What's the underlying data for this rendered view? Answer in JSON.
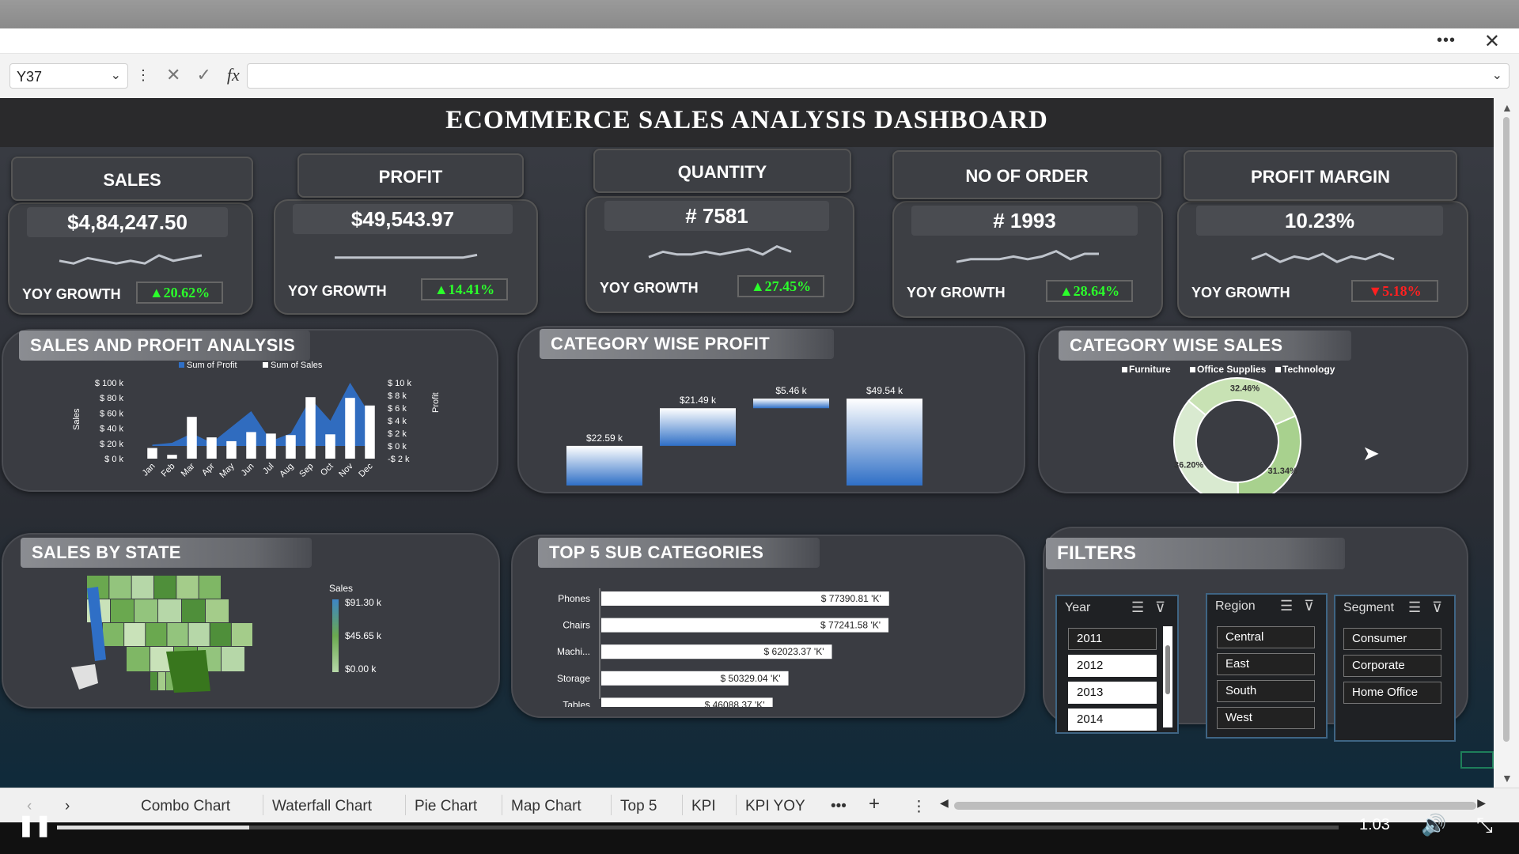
{
  "window": {
    "more_icon": "ellipsis-icon",
    "close_icon": "close-icon"
  },
  "formula_bar": {
    "name_box": "Y37",
    "formula": ""
  },
  "dashboard": {
    "title": "ECOMMERCE SALES ANALYSIS DASHBOARD",
    "kpis": [
      {
        "label": "SALES",
        "value": "$4,84,247.50",
        "yoy_label": "YOY GROWTH",
        "yoy": "20.62%",
        "direction": "up",
        "spark": [
          3,
          2,
          4,
          3,
          2,
          3,
          2,
          5,
          3,
          4,
          5
        ]
      },
      {
        "label": "PROFIT",
        "value": "$49,543.97",
        "yoy_label": "YOY GROWTH",
        "yoy": "14.41%",
        "direction": "up",
        "spark": [
          3,
          3,
          3,
          3,
          3,
          3,
          3,
          3,
          3,
          3,
          4
        ]
      },
      {
        "label": "QUANTITY",
        "value": "# 7581",
        "yoy_label": "YOY GROWTH",
        "yoy": "27.45%",
        "direction": "up",
        "spark": [
          2,
          4,
          3,
          3,
          4,
          3,
          4,
          5,
          3,
          6,
          4
        ]
      },
      {
        "label": "NO OF  ORDER",
        "value": "# 1993",
        "yoy_label": "YOY GROWTH",
        "yoy": "28.64%",
        "direction": "up",
        "spark": [
          2,
          3,
          3,
          3,
          4,
          3,
          4,
          6,
          3,
          5,
          5
        ]
      },
      {
        "label": "PROFIT MARGIN",
        "value": "10.23%",
        "yoy_label": "YOY GROWTH",
        "yoy": "5.18%",
        "direction": "down",
        "spark": [
          3,
          5,
          2,
          4,
          3,
          5,
          2,
          4,
          3,
          5,
          3
        ]
      }
    ],
    "colors": {
      "up": "#2bff2b",
      "down": "#ff2020",
      "profit": "#2f6fc6",
      "sales": "#ffffff",
      "furniture": "#d9ead0",
      "office": "#a8d18e",
      "technology": "#c8e2b4"
    }
  },
  "combo": {
    "title": "SALES AND PROFIT ANALYSIS",
    "legend": [
      "Sum of Profit",
      "Sum of Sales"
    ],
    "left_axis_title": "Sales",
    "right_axis_title": "Profit",
    "left_ticks": [
      "$ 100 k",
      "$ 80 k",
      "$ 60 k",
      "$ 40 k",
      "$ 20 k",
      "$ 0 k"
    ],
    "right_ticks": [
      "$ 10 k",
      "$ 8 k",
      "$ 6 k",
      "$ 4 k",
      "$ 2 k",
      "$ 0 k",
      "-$ 2 k"
    ]
  },
  "waterfall": {
    "title": "CATEGORY WISE PROFIT"
  },
  "donut": {
    "title": "CATEGORY WISE SALES"
  },
  "map": {
    "title": "SALES BY STATE",
    "legend_title": "Sales",
    "legend_ticks": [
      "$91.30 k",
      "$45.65 k",
      "$0.00 k"
    ]
  },
  "top5": {
    "title": "TOP  5 SUB CATEGORIES"
  },
  "chart_data": [
    {
      "type": "bar",
      "title": "SALES AND PROFIT ANALYSIS",
      "categories": [
        "Jan",
        "Feb",
        "Mar",
        "Apr",
        "May",
        "Jun",
        "Jul",
        "Aug",
        "Sep",
        "Oct",
        "Nov",
        "Dec"
      ],
      "series": [
        {
          "name": "Sum of Sales",
          "type": "bar",
          "axis": "left",
          "values": [
            14000,
            5000,
            55000,
            28000,
            23000,
            35000,
            33000,
            31000,
            81000,
            32000,
            80000,
            70000
          ]
        },
        {
          "name": "Sum of Profit",
          "type": "area",
          "axis": "right",
          "values": [
            0.2,
            0.5,
            2.0,
            0.5,
            3.0,
            5.5,
            0.8,
            2.0,
            7.5,
            4.0,
            10.0,
            5.0
          ]
        }
      ],
      "xlabel": "",
      "ylabel": "Sales",
      "y2label": "Profit",
      "ylim": [
        0,
        100000
      ],
      "y2lim": [
        -2,
        10
      ],
      "legend": "top"
    },
    {
      "type": "bar",
      "subtype": "waterfall",
      "title": "CATEGORY WISE PROFIT",
      "categories": [
        "Furniture",
        "Office Supplies",
        "Technology",
        "Total"
      ],
      "values": [
        22.59,
        21.49,
        5.46,
        49.54
      ],
      "labels": [
        "$22.59 k",
        "$21.49 k",
        "$5.46 k",
        "$49.54 k"
      ],
      "ylim": [
        0,
        55
      ]
    },
    {
      "type": "pie",
      "subtype": "donut",
      "title": "CATEGORY WISE SALES",
      "categories": [
        "Furniture",
        "Office Supplies",
        "Technology"
      ],
      "values": [
        36.2,
        31.34,
        32.46
      ],
      "labels": [
        "36.20%",
        "31.34%",
        "32.46%"
      ],
      "legend": "top"
    },
    {
      "type": "bar",
      "orientation": "horizontal",
      "title": "TOP  5 SUB CATEGORIES",
      "categories": [
        "Phones",
        "Chairs",
        "Machi...",
        "Storage",
        "Tables"
      ],
      "values": [
        77390.81,
        77241.58,
        62023.37,
        50329.04,
        46088.37
      ],
      "labels": [
        "$ 77390.81 'K'",
        "$ 77241.58 'K'",
        "$ 62023.37 'K'",
        "$ 50329.04 'K'",
        "$ 46088.37 'K'"
      ],
      "xlim": [
        0,
        100000
      ]
    }
  ],
  "filters": {
    "title": "FILTERS",
    "year": {
      "label": "Year",
      "items": [
        "2011",
        "2012",
        "2013",
        "2014"
      ],
      "selected": [
        1,
        2,
        3
      ]
    },
    "region": {
      "label": "Region",
      "items": [
        "Central",
        "East",
        "South",
        "West"
      ],
      "selected": []
    },
    "segment": {
      "label": "Segment",
      "items": [
        "Consumer",
        "Corporate",
        "Home Office"
      ],
      "selected": []
    }
  },
  "sheet_tabs": [
    "Combo Chart",
    "Waterfall Chart",
    "Pie Chart",
    "Map Chart",
    "Top 5",
    "KPI",
    "KPI YOY"
  ],
  "video": {
    "time": "1:03",
    "progress": 0.15
  }
}
